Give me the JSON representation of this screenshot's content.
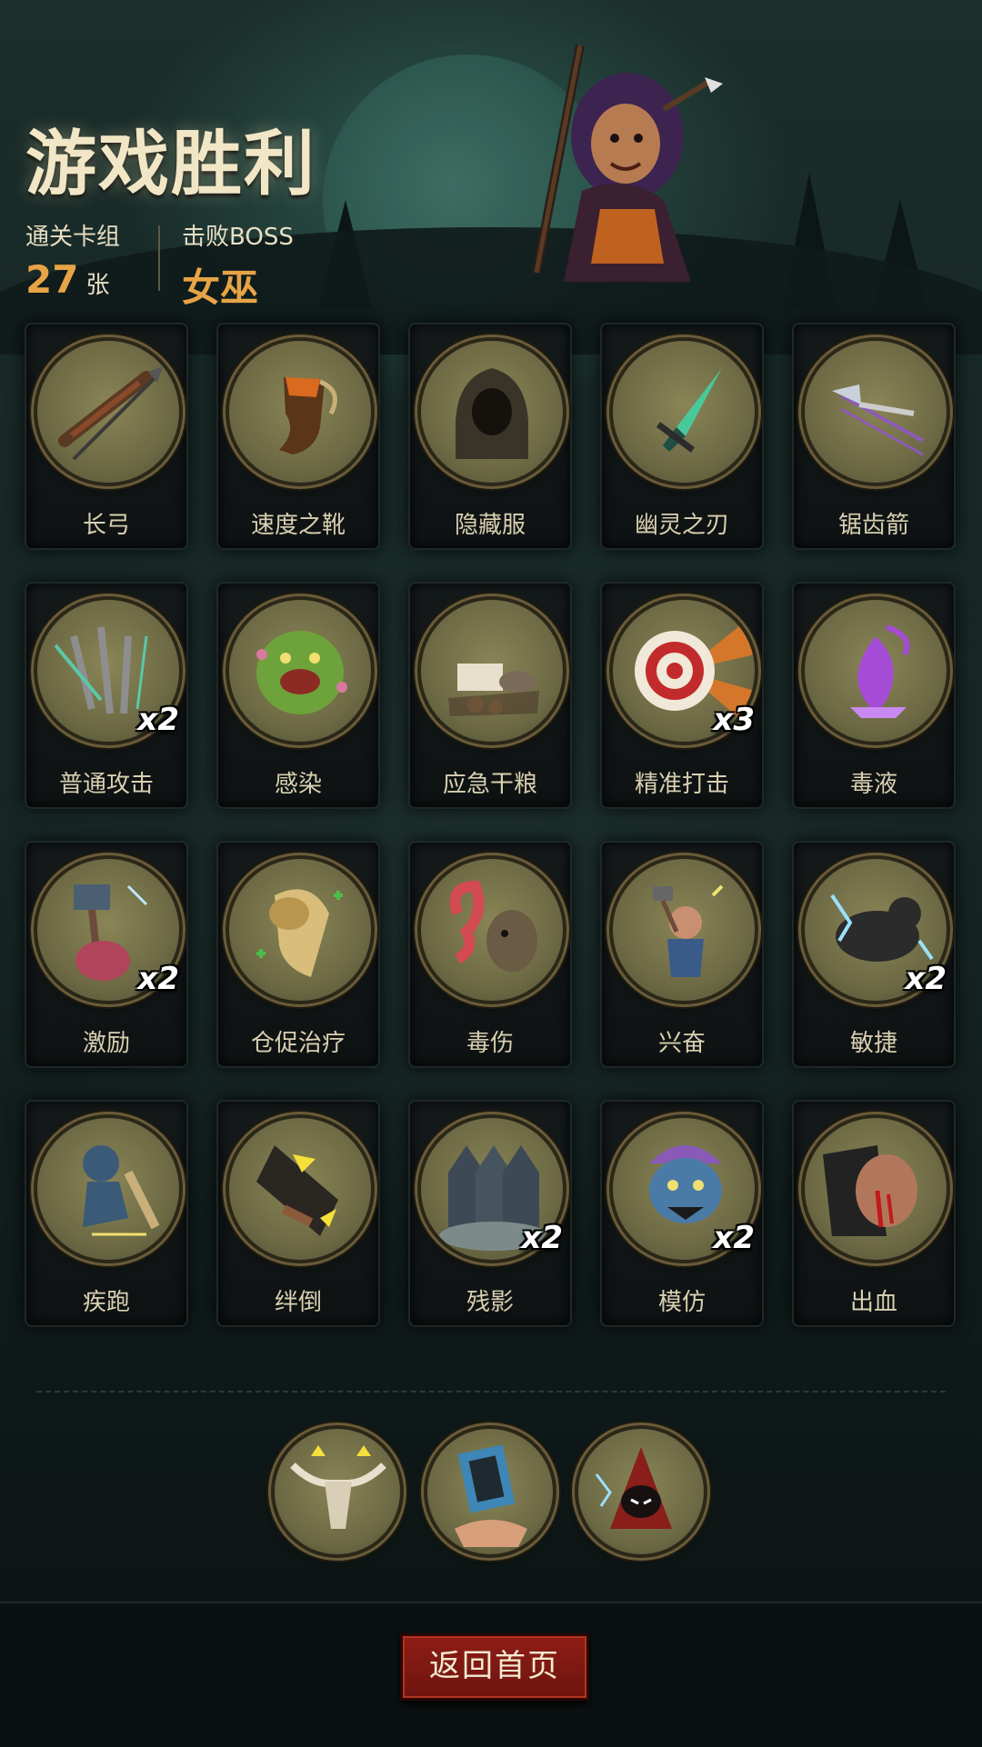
{
  "header": {
    "title": "游戏胜利",
    "deck_label": "通关卡组",
    "deck_count": "27",
    "deck_unit": "张",
    "boss_label": "击败BOSS",
    "boss_name": "女巫"
  },
  "cards": [
    {
      "name": "长弓",
      "count": "",
      "icon": "longbow-icon"
    },
    {
      "name": "速度之靴",
      "count": "",
      "icon": "speed-boots-icon"
    },
    {
      "name": "隐藏服",
      "count": "",
      "icon": "hooded-cloak-icon"
    },
    {
      "name": "幽灵之刃",
      "count": "",
      "icon": "ghost-blade-icon"
    },
    {
      "name": "锯齿箭",
      "count": "",
      "icon": "serrated-arrow-icon"
    },
    {
      "name": "普通攻击",
      "count": "x2",
      "icon": "basic-attack-icon"
    },
    {
      "name": "感染",
      "count": "",
      "icon": "infection-icon"
    },
    {
      "name": "应急干粮",
      "count": "",
      "icon": "ration-icon"
    },
    {
      "name": "精准打击",
      "count": "x3",
      "icon": "target-icon"
    },
    {
      "name": "毒液",
      "count": "",
      "icon": "venom-icon"
    },
    {
      "name": "激励",
      "count": "x2",
      "icon": "inspire-icon"
    },
    {
      "name": "仓促治疗",
      "count": "",
      "icon": "bandage-icon"
    },
    {
      "name": "毒伤",
      "count": "",
      "icon": "poison-wound-icon"
    },
    {
      "name": "兴奋",
      "count": "",
      "icon": "excite-icon"
    },
    {
      "name": "敏捷",
      "count": "x2",
      "icon": "panther-icon"
    },
    {
      "name": "疾跑",
      "count": "",
      "icon": "sprint-icon"
    },
    {
      "name": "绊倒",
      "count": "",
      "icon": "trip-icon"
    },
    {
      "name": "残影",
      "count": "x2",
      "icon": "afterimage-icon"
    },
    {
      "name": "模仿",
      "count": "x2",
      "icon": "mimic-icon"
    },
    {
      "name": "出血",
      "count": "",
      "icon": "bleed-icon"
    }
  ],
  "relics": [
    {
      "icon": "bull-skull-icon"
    },
    {
      "icon": "card-hand-icon"
    },
    {
      "icon": "hooded-mage-icon"
    }
  ],
  "footer": {
    "home_button": "返回首页"
  },
  "colors": {
    "accent": "#e7a446",
    "button": "#8e1d15",
    "medal": "#7a7650"
  }
}
